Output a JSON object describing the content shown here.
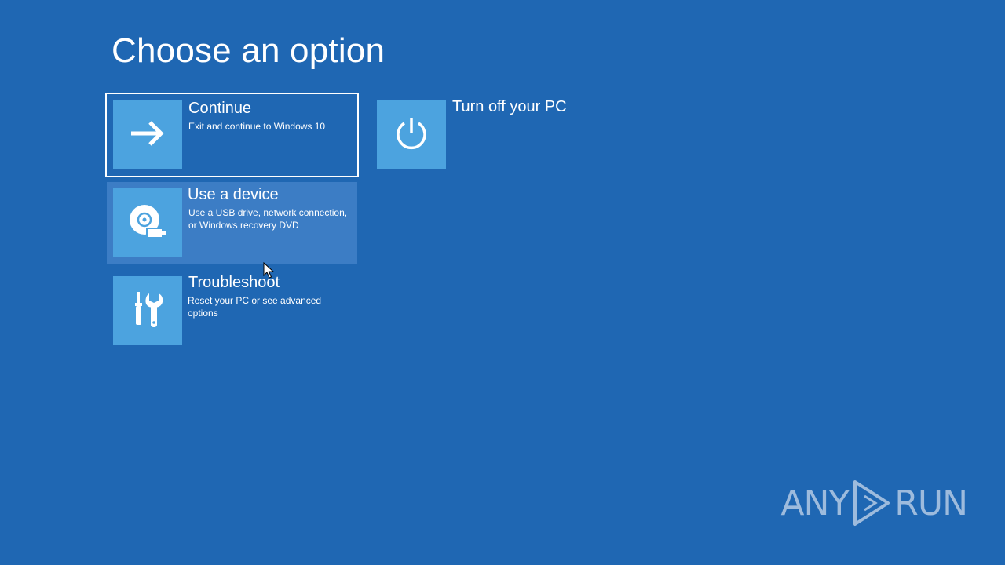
{
  "page": {
    "title": "Choose an option"
  },
  "options": [
    {
      "title": "Continue",
      "description": "Exit and continue to Windows 10",
      "icon": "arrow-right-icon",
      "state": "selected"
    },
    {
      "title": "Use a device",
      "description": "Use a USB drive, network connection, or Windows recovery DVD",
      "icon": "disc-usb-icon",
      "state": "hover"
    },
    {
      "title": "Troubleshoot",
      "description": "Reset your PC or see advanced options",
      "icon": "tools-icon",
      "state": "normal"
    },
    {
      "title": "Turn off your PC",
      "description": "",
      "icon": "power-icon",
      "state": "normal"
    }
  ],
  "watermark": {
    "text_left": "ANY",
    "text_right": "RUN"
  },
  "colors": {
    "background": "#1f67b3",
    "tile": "#4ca3df",
    "hover": "#3c7dc5",
    "text": "#ffffff"
  }
}
